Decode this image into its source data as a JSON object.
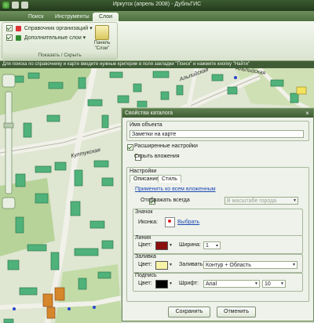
{
  "window": {
    "title": "Иркутск (апрель 2008) - ДубльГИС"
  },
  "ribbon": {
    "tabs": [
      {
        "label": "Поиск"
      },
      {
        "label": "Инструменты"
      },
      {
        "label": "Слои"
      }
    ],
    "layers": [
      {
        "label": "Справочник организаций"
      },
      {
        "label": "Дополнительные слои"
      }
    ],
    "panel_button": "Панель \"Слои\"",
    "group_label": "Показать / Скрыть"
  },
  "hint": "Для поиска по справочнику и карте введите нужные критерии в поля закладки \"Поиск\" и нажмите кнопку \"Найти\"",
  "map": {
    "streets": [
      "Альпийская",
      "Култукская",
      "Альпийская"
    ]
  },
  "dialog": {
    "title": "Свойства каталога",
    "object_name_label": "Имя объекта",
    "object_name_value": "Заметки на карте",
    "extended_label": "Расширенные настройки",
    "hide_nested_label": "Скрыть вложения",
    "settings_label": "Настройки",
    "tabs": [
      {
        "label": "Описание"
      },
      {
        "label": "Стиль"
      }
    ],
    "apply_nested": "Применить ко всем вложенным",
    "always_show": "Отображать всегда",
    "scale_placeholder": "В масштабе города",
    "icon_group": "Значок",
    "icon_label": "Иконка:",
    "choose_link": "Выбрать",
    "line_group": "Линия",
    "color_label": "Цвет:",
    "width_label": "Ширина:",
    "width_value": "1",
    "fill_group": "Заливка",
    "fill_mode_label": "Заливать:",
    "fill_mode_value": "Контур + Область",
    "caption_group": "Подпись",
    "font_label": "Шрифт:",
    "font_value": "Arial",
    "font_size": "10",
    "save": "Сохранить",
    "cancel": "Отменить"
  },
  "colors": {
    "line": "#8b0d0d",
    "fill": "#f7f3a6",
    "caption": "#000000"
  }
}
